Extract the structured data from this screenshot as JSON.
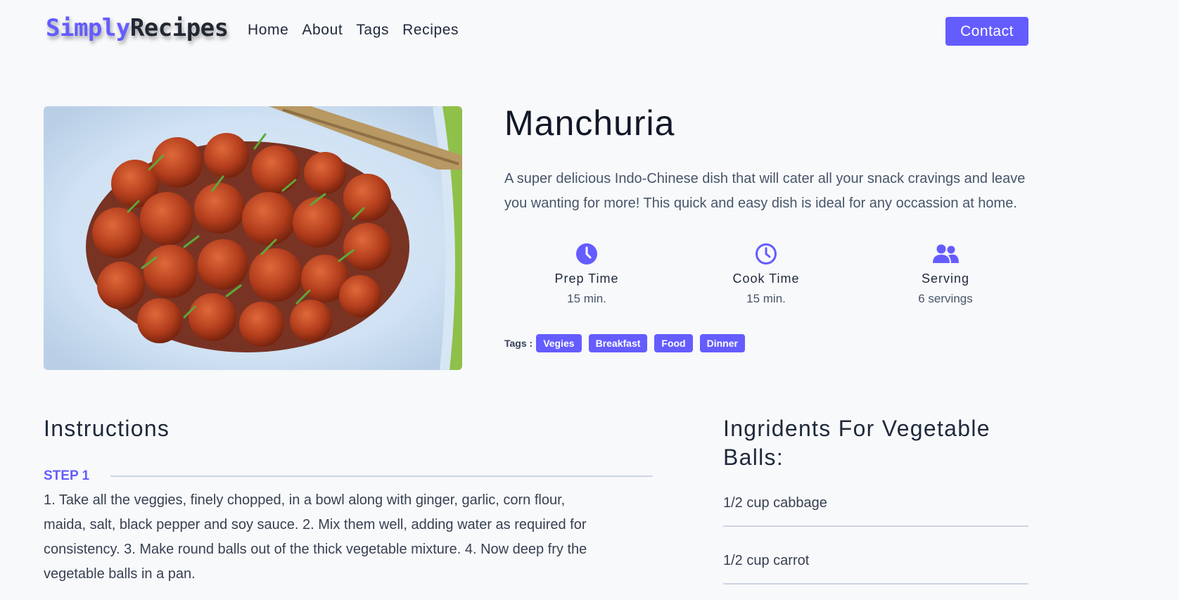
{
  "nav": {
    "logo_part1": "Simply",
    "logo_part2": "Recipes",
    "links": [
      "Home",
      "About",
      "Tags",
      "Recipes"
    ],
    "contact": "Contact"
  },
  "recipe": {
    "title": "Manchuria",
    "description": "A super delicious Indo-Chinese dish that will cater all your snack cravings and leave you wanting for more! This quick and easy dish is ideal for any occassion at home.",
    "info": [
      {
        "icon": "clock-solid-icon",
        "label": "Prep Time",
        "value": "15 min."
      },
      {
        "icon": "clock-outline-icon",
        "label": "Cook Time",
        "value": "15 min."
      },
      {
        "icon": "users-icon",
        "label": "Serving",
        "value": "6 servings"
      }
    ],
    "tags_label": "Tags :",
    "tags": [
      "Vegies",
      "Breakfast",
      "Food",
      "Dinner"
    ]
  },
  "instructions": {
    "heading": "Instructions",
    "steps": [
      {
        "label": "STEP 1",
        "text": "1. Take all the veggies, finely chopped, in a bowl along with ginger, garlic, corn flour, maida, salt, black pepper and soy sauce. 2. Mix them well, adding water as required for consistency. 3. Make round balls out of the thick vegetable mixture. 4. Now deep fry the vegetable balls in a pan."
      }
    ]
  },
  "ingredients": {
    "heading": "Ingridents For Vegetable Balls:",
    "items": [
      "1/2 cup cabbage",
      "1/2 cup carrot"
    ]
  },
  "colors": {
    "accent": "#645cff",
    "background": "#f8f9fb",
    "text": "#1e293b"
  }
}
